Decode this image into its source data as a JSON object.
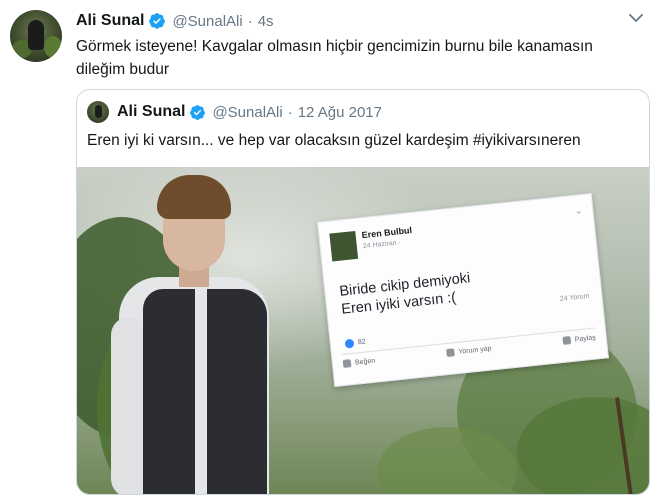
{
  "tweet": {
    "name": "Ali Sunal",
    "handle": "@SunalAli",
    "separator": "·",
    "time": "4s",
    "text": "Görmek isteyene! Kavgalar olmasın hiçbir gencimizin burnu bile kanamasın dileğim budur"
  },
  "quoted": {
    "name": "Ali Sunal",
    "handle": "@SunalAli",
    "separator": "·",
    "date": "12 Ağu 2017",
    "text": "Eren iyi ki varsın... ve hep var olacaksın güzel kardeşim #iyikivarsıneren",
    "fb_post": {
      "name": "Eren Bulbul",
      "date": "24 Haziran ·",
      "line1": "Biride cikip demiyoki",
      "line2": "Eren iyiki varsın :(",
      "time_ago": "24 Yorum",
      "likes": "82",
      "actions": [
        "Beğen",
        "Yorum yap",
        "Paylaş"
      ]
    }
  },
  "icons": {
    "verified": "verified-badge-icon",
    "caret": "chevron-down-icon"
  },
  "colors": {
    "verified": "#1da1f2",
    "secondary_text": "#657786",
    "border": "#ccd6dd",
    "facebook_blue": "#2d88ff"
  }
}
